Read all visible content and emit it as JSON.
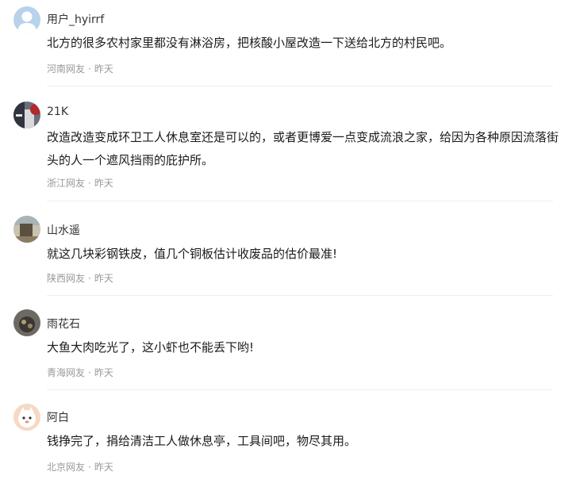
{
  "comments": [
    {
      "user": "用户_hyirrf",
      "text": "北方的很多农村家里都没有淋浴房，把核酸小屋改造一下送给北方的村民吧。",
      "location": "河南网友",
      "separator": "·",
      "time": "昨天",
      "avatar_icon": "default-user-avatar"
    },
    {
      "user": "21K",
      "text": "改造改造变成环卫工人休息室还是可以的，或者更博爱一点变成流浪之家，给因为各种原因流落街头的人一个遮风挡雨的庇护所。",
      "location": "浙江网友",
      "separator": "·",
      "time": "昨天",
      "avatar_icon": "photo-avatar"
    },
    {
      "user": "山水遥",
      "text": "就这几块彩钢铁皮，值几个铜板估计收废品的估价最准!",
      "location": "陕西网友",
      "separator": "·",
      "time": "昨天",
      "avatar_icon": "photo-avatar"
    },
    {
      "user": "雨花石",
      "text": "大鱼大肉吃光了，这小虾也不能丢下哟!",
      "location": "青海网友",
      "separator": "·",
      "time": "昨天",
      "avatar_icon": "photo-avatar"
    },
    {
      "user": "阿白",
      "text": "钱挣完了，捐给清洁工人做休息亭，工具间吧，物尽其用。",
      "location": "北京网友",
      "separator": "·",
      "time": "昨天",
      "avatar_icon": "cartoon-avatar"
    }
  ],
  "colors": {
    "username": "#333333",
    "content": "#1a1a1a",
    "meta": "#999999",
    "divider": "#eeeeee",
    "default_avatar_bg": "#b8d2ec"
  }
}
